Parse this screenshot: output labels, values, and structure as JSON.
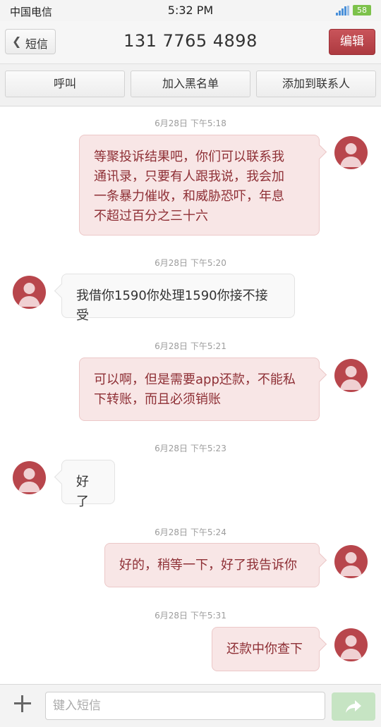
{
  "status": {
    "carrier": "中国电信",
    "time": "5:32 PM",
    "battery": "58",
    "network": "4G"
  },
  "header": {
    "back_label": "短信",
    "title": "131 7765 4898",
    "edit_label": "编辑"
  },
  "actions": [
    "呼叫",
    "加入黑名单",
    "添加到联系人"
  ],
  "messages": [
    {
      "time": "6月28日 下午5:18",
      "direction": "out",
      "lines": [
        "等聚投诉结果吧，你们可以联系我",
        "通讯录，只要有人跟我说，我会加",
        "一条暴力催收，和威胁恐吓，年息",
        "不超过百分之三十六"
      ]
    },
    {
      "time": "6月28日 下午5:20",
      "direction": "in",
      "lines": [
        "我借你1590你处理1590你接不接受"
      ]
    },
    {
      "time": "6月28日 下午5:21",
      "direction": "out",
      "lines": [
        "可以啊，但是需要app还款，不能私",
        "下转账，而且必须销账"
      ]
    },
    {
      "time": "6月28日 下午5:23",
      "direction": "in",
      "lines": [
        "好了"
      ]
    },
    {
      "time": "6月28日 下午5:24",
      "direction": "out",
      "lines": [
        "好的，稍等一下，好了我告诉你"
      ]
    },
    {
      "time": "6月28日 下午5:31",
      "direction": "out",
      "lines": [
        "还款中你查下"
      ]
    }
  ],
  "compose": {
    "placeholder": "键入短信"
  },
  "colors": {
    "accent": "#b8464c",
    "out_bubble": "#f8e6e6",
    "out_text": "#8e2f35",
    "send": "#c6e4c3"
  }
}
